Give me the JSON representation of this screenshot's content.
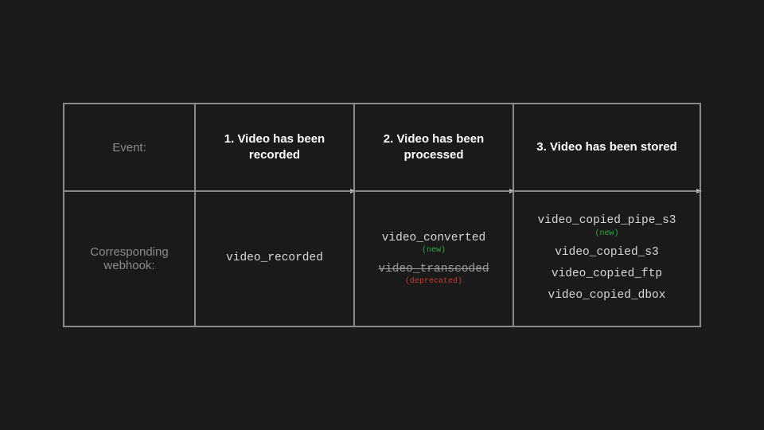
{
  "rowheaders": {
    "event": "Event:",
    "webhook": "Corresponding webhook:"
  },
  "events": {
    "c1": "1. Video has been recorded",
    "c2": "2. Video has been processed",
    "c3": "3. Video has been stored"
  },
  "webhooks": {
    "c1": {
      "a": "video_recorded"
    },
    "c2": {
      "a": "video_converted",
      "a_tag": "(new)",
      "b": "video_transcoded",
      "b_tag": "(deprecated)"
    },
    "c3": {
      "a": "video_copied_pipe_s3",
      "a_tag": "(new)",
      "b": "video_copied_s3",
      "c": "video_copied_ftp",
      "d": "video_copied_dbox"
    }
  }
}
